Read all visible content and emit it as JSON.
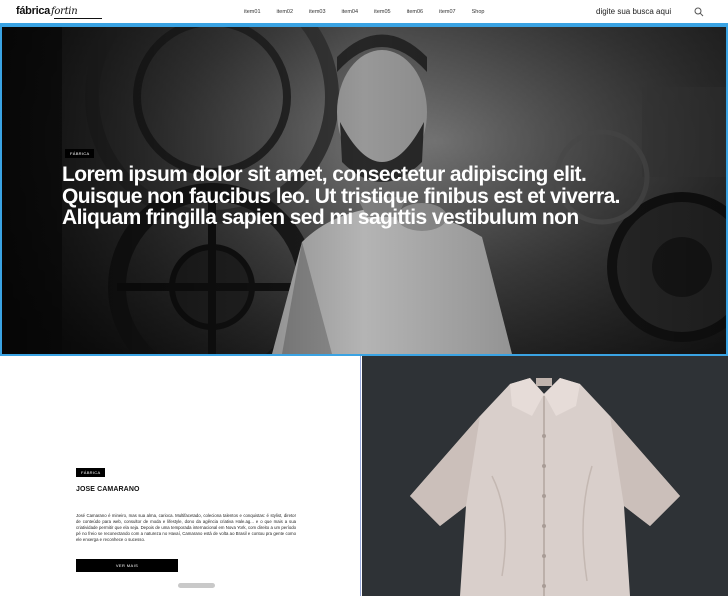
{
  "header": {
    "logo_main": "fábrica",
    "logo_script": "fortin",
    "nav": [
      "item01",
      "item02",
      "item03",
      "item04",
      "item05",
      "item06",
      "item07",
      "Shop"
    ],
    "search_placeholder": "digite sua busca aqui",
    "search_icon": "search-icon"
  },
  "hero": {
    "badge": "FÁBRICA",
    "headline": "Lorem ipsum dolor sit amet, consectetur adipiscing elit. Quisque non faucibus leo. Ut tristique finibus est et viverra. Aliquam fringilla sapien sed mi sagittis vestibulum non"
  },
  "feature": {
    "badge": "FÁBRICA",
    "name": "JOSE CAMARANO",
    "bio": "José Camarano é mineiro, mas sua alma, carioca. Multifacetado, coleciona talentos e conquistas: é stylist, diretor de conteúdo para web, consultor de moda e lifestyle, dono da agência criativa Hale.ag... e o que mais a sua criatividade permitir que ela seja. Depois de uma temporada internacional em Nova York, com direito a um período pé no freio se reconectando com a natureza no Havaí, Camarano está de volta ao Brasil e contou pra gente como ele enxerga e reconhece o sucesso.",
    "cta": "VER MAIS"
  },
  "colors": {
    "accent": "#3aa3e3",
    "dark_panel": "#2e3236"
  }
}
